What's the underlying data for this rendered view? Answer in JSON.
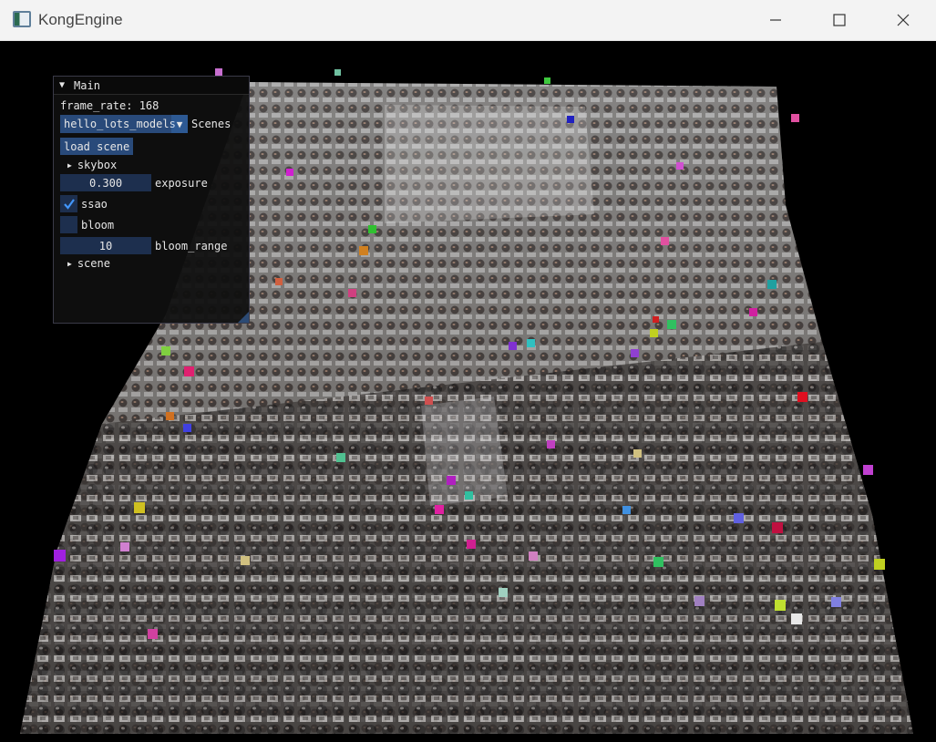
{
  "window": {
    "title": "KongEngine",
    "minimize_icon": "minimize-icon",
    "maximize_icon": "maximize-icon",
    "close_icon": "close-icon"
  },
  "panel": {
    "title": "Main",
    "frame_rate_text": "frame_rate: 168",
    "scene_combo_value": "hello_lots_models",
    "scene_combo_label": "Scenes",
    "load_scene_label": "load scene",
    "skybox_label": "skybox",
    "exposure_value": "0.300",
    "exposure_label": "exposure",
    "ssao_label": "ssao",
    "ssao_checked": true,
    "bloom_label": "bloom",
    "bloom_checked": false,
    "bloom_range_value": "10",
    "bloom_range_label": "bloom_range",
    "scene_tree_label": "scene"
  },
  "colors": {
    "titlebar_bg": "#f3f3f3",
    "panel_bg": "#0f0f0f",
    "widget_bg": "#294a7a",
    "frame_bg": "#1d2f4e",
    "render_bg": "#000000"
  }
}
